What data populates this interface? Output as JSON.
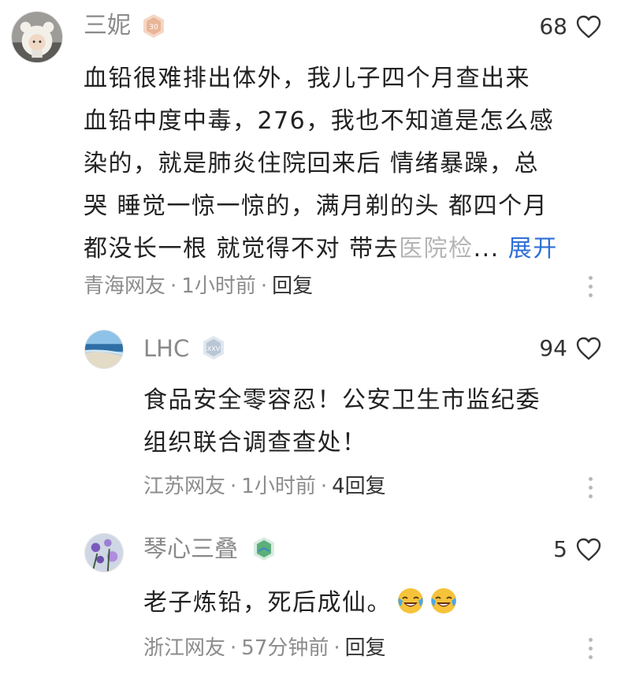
{
  "comments": [
    {
      "username": "三妮",
      "like_count": "68",
      "body_lines": [
        "血铅很难排出体外，我儿子四个月查出来",
        "血铅中度中毒，276，我也不知道是怎么感",
        "染的，就是肺炎住院回来后 情绪暴躁，总",
        "哭 睡觉一惊一惊的，满月剃的头 都四个月"
      ],
      "last_line_visible": "都没长一根 就觉得不对 带去",
      "last_line_faded": "医院检",
      "ellipsis": "...",
      "expand_label": "展开",
      "region": "青海网友",
      "time": "1小时前",
      "reply_label": "回复"
    },
    {
      "username": "LHC",
      "like_count": "94",
      "body_lines": [
        "食品安全零容忍！公安卫生市监纪委",
        "组织联合调查查处！"
      ],
      "region": "江苏网友",
      "time": "1小时前",
      "reply_label": "4回复"
    },
    {
      "username": "琴心三叠",
      "like_count": "5",
      "body_text": "老子炼铅，死后成仙。",
      "emojis": [
        "laugh-cry-emoji",
        "laugh-cry-emoji"
      ],
      "region": "浙江网友",
      "time": "57分钟前",
      "reply_label": "回复"
    }
  ],
  "separator": "·",
  "colors": {
    "username": "#8a8a8a",
    "body": "#222222",
    "meta": "#8c8c8c",
    "expand": "#2f6fd6"
  }
}
